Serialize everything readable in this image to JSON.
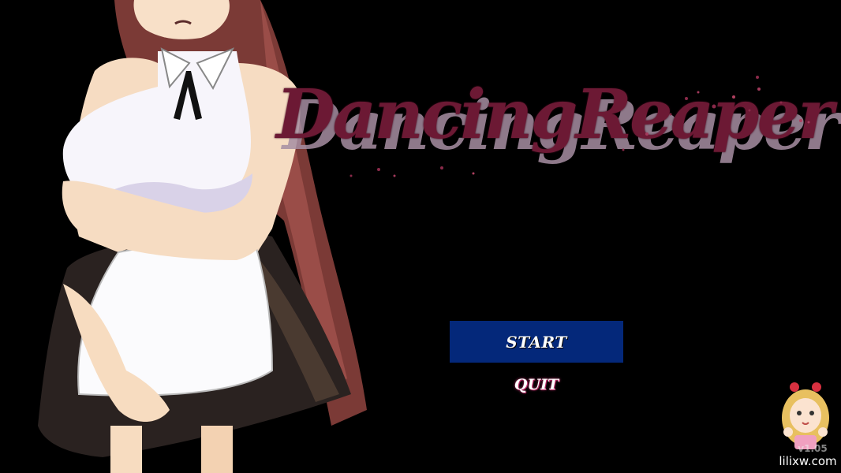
{
  "game": {
    "title": "DancingReaper"
  },
  "menu": {
    "start_label": "START",
    "quit_label": "QUIT"
  },
  "footer": {
    "version": "v1.05",
    "watermark": "lilixw.com"
  },
  "colors": {
    "background": "#000000",
    "title": "#6c1934",
    "title_shadow": "#a78fa3",
    "start_button_bg": "#04287a",
    "quit_glow": "#d23a7a"
  }
}
